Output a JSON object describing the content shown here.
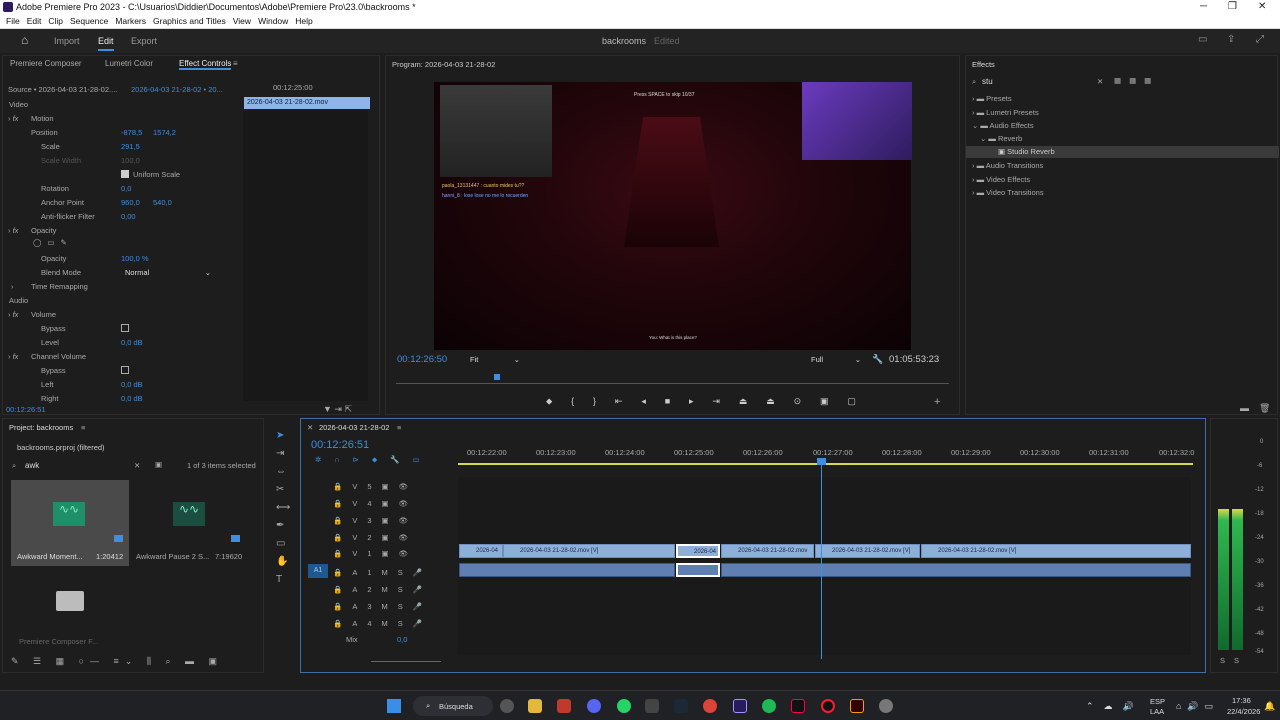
{
  "app": {
    "title": "Adobe Premiere Pro 2023 - C:\\Usuarios\\Diddier\\Documentos\\Adobe\\Premiere Pro\\23.0\\backrooms *"
  },
  "menu": [
    "File",
    "Edit",
    "Clip",
    "Sequence",
    "Markers",
    "Graphics and Titles",
    "View",
    "Window",
    "Help"
  ],
  "workspace": {
    "tabs": [
      "Import",
      "Edit",
      "Export"
    ],
    "project_name": "backrooms",
    "status": "Edited"
  },
  "effect_controls": {
    "tabs": [
      "Premiere Composer",
      "Lumetri Color",
      "Effect Controls"
    ],
    "source": "Source • 2026-04-03 21-28-02....",
    "sequence": "2026-04-03 21-28-02 • 20...",
    "timecode": "00:12:25:00",
    "clip_name": "2026-04-03 21-28-02.mov",
    "video_header": "Video",
    "audio_header": "Audio",
    "motion": "Motion",
    "position": "Position",
    "pos_x": "-878,5",
    "pos_y": "1574,2",
    "scale": "Scale",
    "scale_val": "291,5",
    "scale_width": "Scale Width",
    "scale_width_val": "100,0",
    "uniform_scale": "Uniform Scale",
    "rotation": "Rotation",
    "rotation_val": "0,0",
    "anchor": "Anchor Point",
    "anchor_x": "960,0",
    "anchor_y": "540,0",
    "antiflicker": "Anti-flicker Filter",
    "antiflicker_val": "0,00",
    "opacity_fx": "Opacity",
    "opacity": "Opacity",
    "opacity_val": "100,0 %",
    "blend": "Blend Mode",
    "blend_val": "Normal",
    "time_remap": "Time Remapping",
    "volume": "Volume",
    "bypass": "Bypass",
    "level": "Level",
    "level_val": "0,0 dB",
    "channel_volume": "Channel Volume",
    "left": "Left",
    "left_val": "0,0 dB",
    "right": "Right",
    "right_val": "0,0 dB",
    "bottom_tc": "00:12:26:51"
  },
  "program": {
    "title": "Program: 2026-04-03 21-28-02",
    "timecode": "00:12:26:50",
    "fit": "Fit",
    "quality": "Full",
    "duration": "01:05:53:23",
    "overlay_top": "Press SPACE to skip 10/37",
    "chat_1": "paola_13131447 : cuanto mides tu??",
    "chat_2": "hanni_8 : lose lose no me lo recuerden",
    "subtitle": "You: What is this place?"
  },
  "effects": {
    "title": "Effects",
    "search": "stu",
    "tree": [
      {
        "label": "Presets",
        "level": 0
      },
      {
        "label": "Lumetri Presets",
        "level": 0
      },
      {
        "label": "Audio Effects",
        "level": 0
      },
      {
        "label": "Reverb",
        "level": 1
      },
      {
        "label": "Studio Reverb",
        "level": 2
      },
      {
        "label": "Audio Transitions",
        "level": 0
      },
      {
        "label": "Video Effects",
        "level": 0
      },
      {
        "label": "Video Transitions",
        "level": 0
      }
    ]
  },
  "project": {
    "title": "Project: backrooms",
    "filter_label": "backrooms.prproj (filtered)",
    "search": "awk",
    "count": "1 of 3 items selected",
    "items": [
      {
        "name": "Awkward Moment...",
        "dur": "1:20412"
      },
      {
        "name": "Awkward Pause 2 S...",
        "dur": "7:19620"
      },
      {
        "name": "Premiere Composer F...",
        "dur": ""
      }
    ]
  },
  "timeline": {
    "title": "2026-04-03 21-28-02",
    "timecode": "00:12:26:51",
    "ruler": [
      "00:12:22:00",
      "00:12:23:00",
      "00:12:24:00",
      "00:12:25:00",
      "00:12:26:00",
      "00:12:27:00",
      "00:12:28:00",
      "00:12:29:00",
      "00:12:30:00",
      "00:12:31:00",
      "00:12:32:0"
    ],
    "video_tracks": [
      "V5",
      "V4",
      "V3",
      "V2",
      "V1"
    ],
    "audio_tracks": [
      "A1",
      "A2",
      "A3",
      "A4"
    ],
    "mix_label": "Mix",
    "mix_val": "0,0",
    "source_a1": "A1",
    "clips": [
      "2026-04",
      "2026-04-03 21-28-02.mov [V]",
      "2026-04",
      "2026-04-03 21-28-02.mov",
      "2026-04-03 21-28-02.mov [V]",
      "2026-04-03 21-28-02.mov [V]"
    ]
  },
  "meter": {
    "scale": [
      "0",
      "-6",
      "-12",
      "-18",
      "-24",
      "-30",
      "-36",
      "-42",
      "-48",
      "-54"
    ],
    "solo": [
      "S",
      "S"
    ]
  },
  "taskbar": {
    "search": "Búsqueda",
    "lang": "ESP",
    "layout": "LAA",
    "time": "17:36",
    "date": "22/4/2026"
  }
}
